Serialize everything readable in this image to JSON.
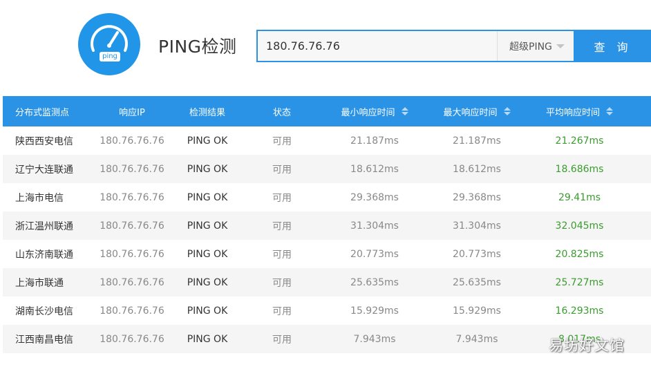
{
  "header": {
    "logo_text": "ping",
    "title": "PING检测"
  },
  "search": {
    "value": "180.76.76.76",
    "mode": "超级PING",
    "query_label": "查 询"
  },
  "table": {
    "columns": [
      "分布式监测点",
      "响应IP",
      "检测结果",
      "状态",
      "最小响应时间",
      "最大响应时间",
      "平均响应时间"
    ],
    "rows": [
      {
        "location": "陕西西安电信",
        "ip": "180.76.76.76",
        "result": "PING OK",
        "status": "可用",
        "min": "21.187ms",
        "max": "21.187ms",
        "avg": "21.267ms"
      },
      {
        "location": "辽宁大连联通",
        "ip": "180.76.76.76",
        "result": "PING OK",
        "status": "可用",
        "min": "18.612ms",
        "max": "18.612ms",
        "avg": "18.686ms"
      },
      {
        "location": "上海市电信",
        "ip": "180.76.76.76",
        "result": "PING OK",
        "status": "可用",
        "min": "29.368ms",
        "max": "29.368ms",
        "avg": "29.41ms"
      },
      {
        "location": "浙江温州联通",
        "ip": "180.76.76.76",
        "result": "PING OK",
        "status": "可用",
        "min": "31.304ms",
        "max": "31.304ms",
        "avg": "32.045ms"
      },
      {
        "location": "山东济南联通",
        "ip": "180.76.76.76",
        "result": "PING OK",
        "status": "可用",
        "min": "20.773ms",
        "max": "20.773ms",
        "avg": "20.825ms"
      },
      {
        "location": "上海市联通",
        "ip": "180.76.76.76",
        "result": "PING OK",
        "status": "可用",
        "min": "25.635ms",
        "max": "25.635ms",
        "avg": "25.727ms"
      },
      {
        "location": "湖南长沙电信",
        "ip": "180.76.76.76",
        "result": "PING OK",
        "status": "可用",
        "min": "15.929ms",
        "max": "15.929ms",
        "avg": "16.293ms"
      },
      {
        "location": "江西南昌电信",
        "ip": "180.76.76.76",
        "result": "PING OK",
        "status": "可用",
        "min": "7.943ms",
        "max": "7.943ms",
        "avg": "8.017ms"
      }
    ]
  },
  "watermark": "易坊好文馆",
  "colors": {
    "accent": "#2a93e6",
    "avg_green": "#3a9c2e",
    "row_alt": "#f5f5f5"
  }
}
